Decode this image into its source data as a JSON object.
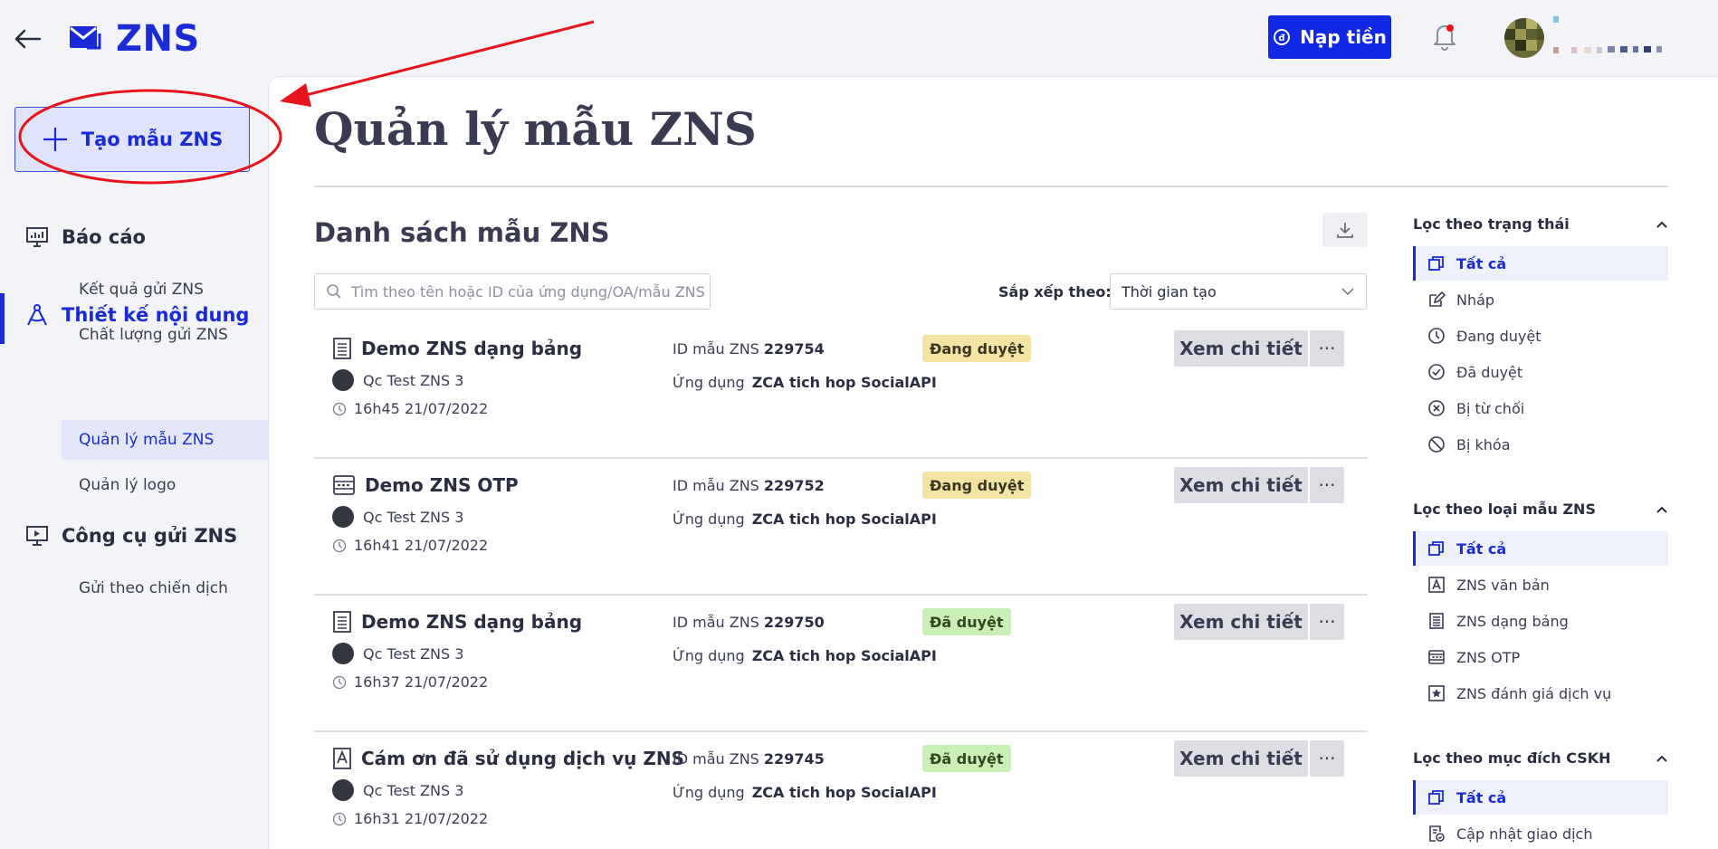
{
  "header": {
    "app_name": "ZNS",
    "topup_label": "Nạp tiền"
  },
  "sidebar": {
    "create_label": "Tạo mẫu ZNS",
    "groups": [
      {
        "label": "Báo cáo",
        "icon": "monitor-chart-icon",
        "items": [
          "Kết quả gửi ZNS",
          "Chất lượng gửi ZNS"
        ]
      },
      {
        "label": "Thiết kế nội dung",
        "icon": "compass-icon",
        "items": [
          "Quản lý mẫu ZNS",
          "Quản lý logo"
        ]
      },
      {
        "label": "Công cụ gửi ZNS",
        "icon": "presentation-icon",
        "items": [
          "Gửi theo chiến dịch"
        ]
      }
    ],
    "active_item": "Quản lý mẫu ZNS"
  },
  "main": {
    "title": "Quản lý mẫu ZNS",
    "list_title": "Danh sách mẫu ZNS",
    "search_placeholder": "Tìm theo tên hoặc ID của ứng dụng/OA/mẫu ZNS",
    "sort_label": "Sắp xếp theo:",
    "sort_value": "Thời gian tạo",
    "id_label": "ID mẫu ZNS",
    "app_label": "Ứng dụng",
    "view_label": "Xem chi tiết",
    "more_label": "···",
    "rows": [
      {
        "name": "Demo ZNS dạng bảng",
        "icon": "table-doc-icon",
        "oa": "Qc Test ZNS 3",
        "time": "16h45 21/07/2022",
        "id": "229754",
        "app": "ZCA tich hop SocialAPI",
        "status": "Đang duyệt",
        "status_type": "pending"
      },
      {
        "name": "Demo ZNS OTP",
        "icon": "otp-icon",
        "oa": "Qc Test ZNS 3",
        "time": "16h41 21/07/2022",
        "id": "229752",
        "app": "ZCA tich hop SocialAPI",
        "status": "Đang duyệt",
        "status_type": "pending"
      },
      {
        "name": "Demo ZNS dạng bảng",
        "icon": "table-doc-icon",
        "oa": "Qc Test ZNS 3",
        "time": "16h37 21/07/2022",
        "id": "229750",
        "app": "ZCA tich hop SocialAPI",
        "status": "Đã duyệt",
        "status_type": "approved"
      },
      {
        "name": "Cám ơn đã sử dụng dịch vụ ZNS...",
        "icon": "text-doc-icon",
        "oa": "Qc Test ZNS 3",
        "time": "16h31 21/07/2022",
        "id": "229745",
        "app": "ZCA tich hop SocialAPI",
        "status": "Đã duyệt",
        "status_type": "approved"
      }
    ]
  },
  "filters": {
    "status": {
      "title": "Lọc theo trạng thái",
      "items": [
        "Tất cả",
        "Nháp",
        "Đang duyệt",
        "Đã duyệt",
        "Bị từ chối",
        "Bị khóa"
      ]
    },
    "type": {
      "title": "Lọc theo loại mẫu ZNS",
      "items": [
        "Tất cả",
        "ZNS văn bản",
        "ZNS dạng bảng",
        "ZNS OTP",
        "ZNS đánh giá dịch vụ"
      ]
    },
    "purpose": {
      "title": "Lọc theo mục đích CSKH",
      "items": [
        "Tất cả",
        "Cập nhật giao dịch"
      ]
    }
  },
  "colors": {
    "brand": "#1a2bd6",
    "pending": "#f3e4a4",
    "approved": "#c9efb6",
    "annotation": "#e8141b"
  }
}
